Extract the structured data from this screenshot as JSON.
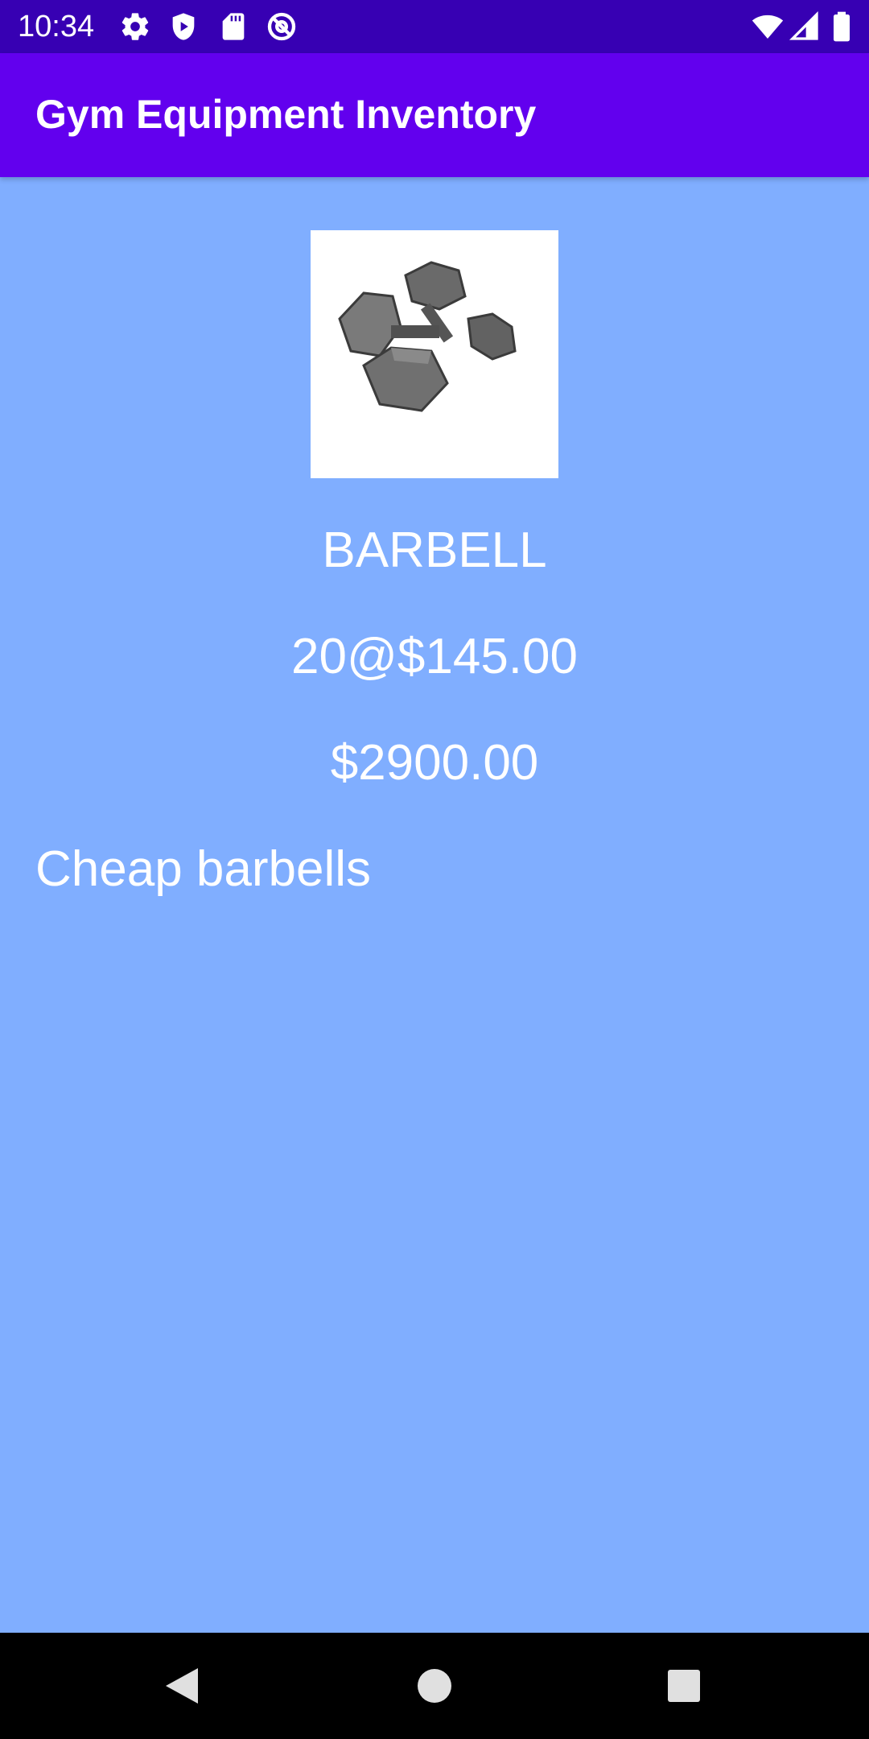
{
  "status_bar": {
    "time": "10:34",
    "left_icons": [
      "gear-icon",
      "shield-play-icon",
      "sd-card-icon",
      "at-sign-icon"
    ],
    "right_icons": [
      "wifi-icon",
      "signal-icon",
      "battery-icon"
    ],
    "color": "#3700b3"
  },
  "app_bar": {
    "title": "Gym Equipment Inventory",
    "color": "#6200ee"
  },
  "product": {
    "image": "dumbbells-image",
    "name": "BARBELL",
    "qty_price": "20@$145.00",
    "total": "$2900.00",
    "description": "Cheap barbells"
  },
  "background_color": "#80aeff",
  "nav_bar": {
    "buttons": [
      "back-icon",
      "home-icon",
      "recents-icon"
    ]
  }
}
